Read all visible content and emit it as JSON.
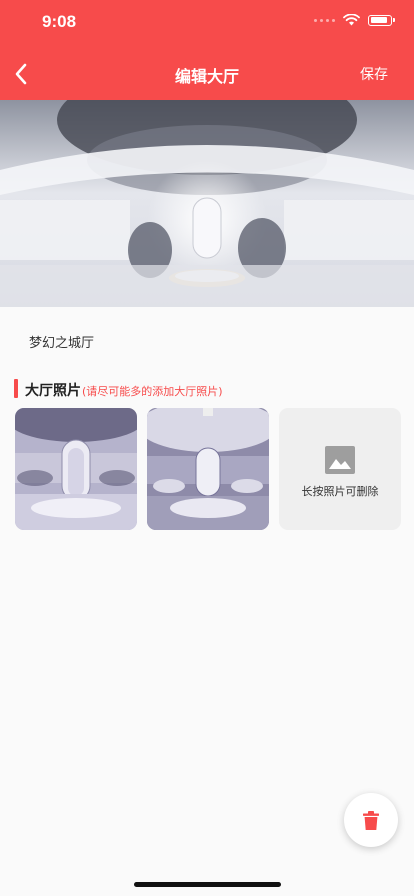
{
  "status_bar": {
    "time": "9:08"
  },
  "header": {
    "title": "编辑大厅",
    "save_label": "保存"
  },
  "hall": {
    "name": "梦幻之城厅"
  },
  "photos_section": {
    "title": "大厅照片",
    "hint": "(请尽可能多的添加大厅照片)",
    "add_tile_label": "长按照片可删除"
  },
  "colors": {
    "accent": "#f74b4b",
    "background": "#fafafa",
    "tile": "#efefef"
  },
  "icons": {
    "back": "chevron-left-icon",
    "add_photo": "image-icon",
    "delete": "trash-icon"
  }
}
